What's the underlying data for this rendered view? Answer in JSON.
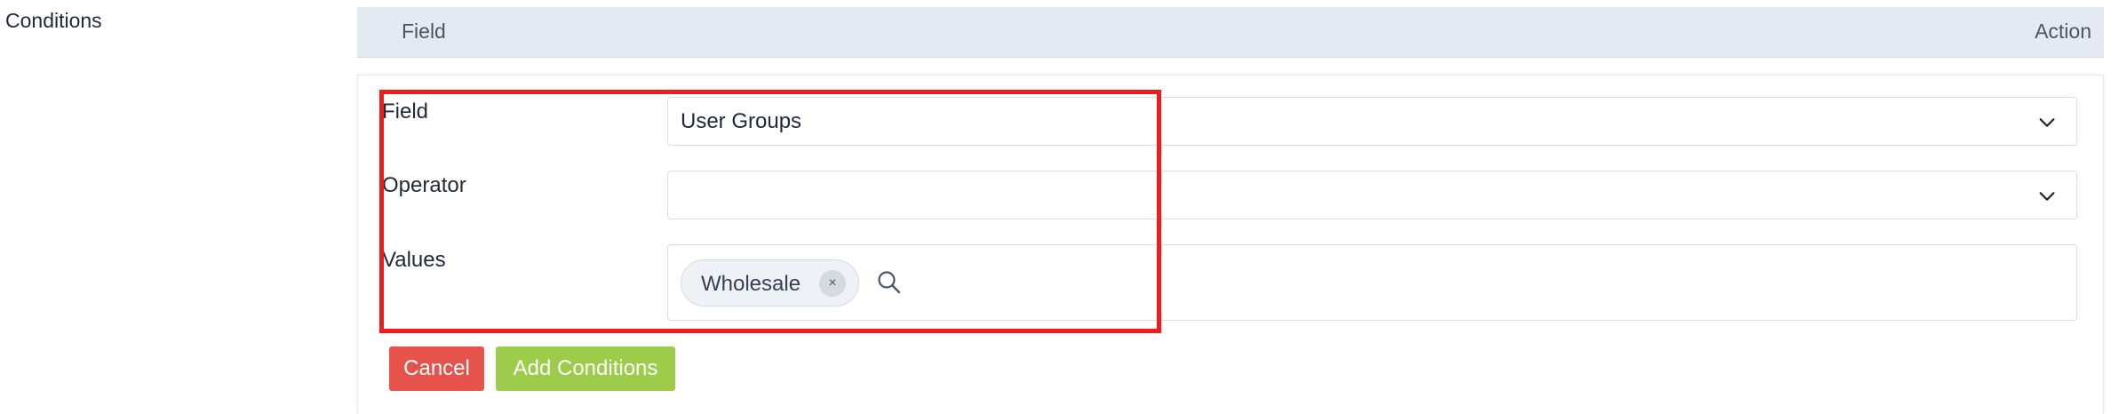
{
  "section": {
    "label": "Conditions"
  },
  "table_header": {
    "field": "Field",
    "action": "Action"
  },
  "form": {
    "field": {
      "label": "Field",
      "value": "User Groups",
      "icon": "chevron-down-icon"
    },
    "operator": {
      "label": "Operator",
      "value": "",
      "icon": "chevron-down-icon"
    },
    "values": {
      "label": "Values",
      "chips": [
        {
          "text": "Wholesale",
          "remove": "×"
        }
      ],
      "icon": "search-icon"
    }
  },
  "buttons": {
    "cancel": "Cancel",
    "add": "Add Conditions"
  },
  "colors": {
    "highlight": "#ee1c1c",
    "cancel": "#e5534b",
    "add": "#9ccc4a",
    "header_bg": "#e5e9f1"
  }
}
